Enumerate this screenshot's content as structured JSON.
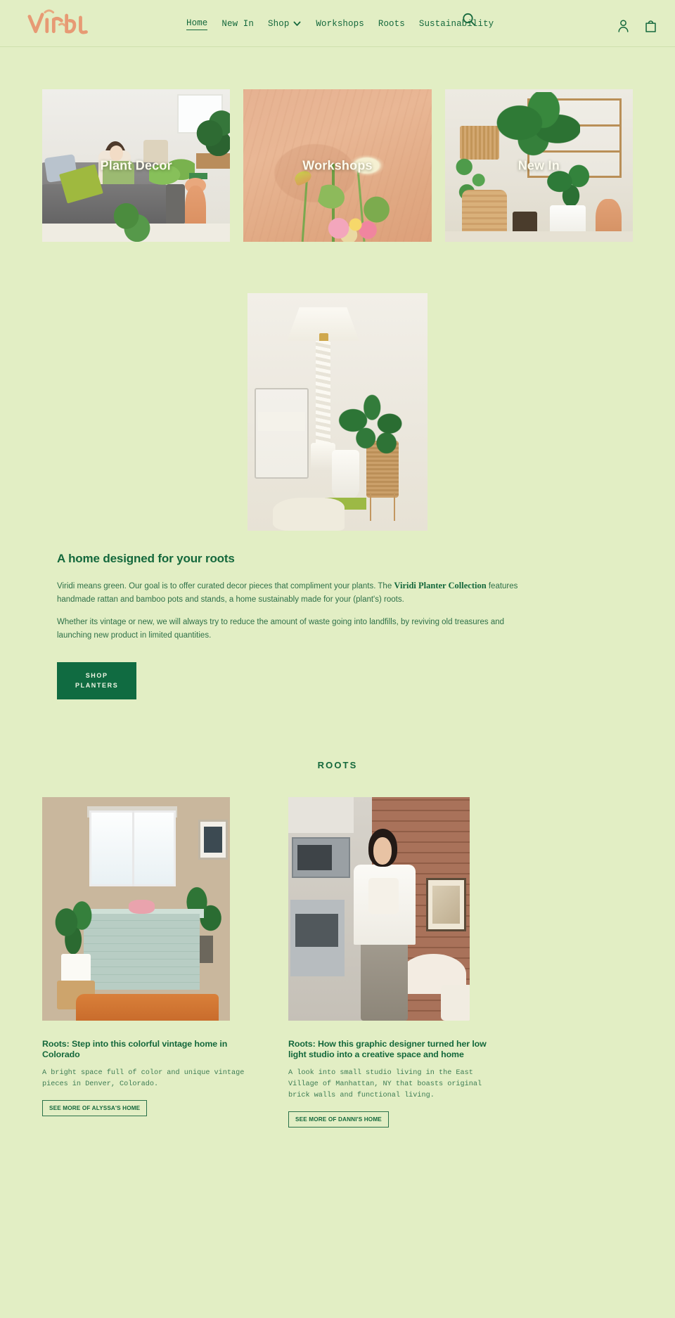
{
  "site": {
    "brand": "Viridi",
    "background_color": "#e2eec4",
    "primary_color": "#14683c",
    "logo_color": "#e79a74"
  },
  "header": {
    "logo_label": "Viridi",
    "nav": [
      {
        "label": "Home",
        "active": true,
        "has_caret": false
      },
      {
        "label": "New In",
        "active": false,
        "has_caret": false
      },
      {
        "label": "Shop",
        "active": false,
        "has_caret": true
      },
      {
        "label": "Workshops",
        "active": false,
        "has_caret": false
      },
      {
        "label": "Roots",
        "active": false,
        "has_caret": false
      },
      {
        "label": "Sustainability",
        "active": false,
        "has_caret": false
      }
    ],
    "search_icon": "search-icon",
    "account_icon": "account-icon",
    "cart_icon": "shopping-bag-icon"
  },
  "categories": [
    {
      "label": "Plant Decor",
      "image_alt": "Woman reading on a grey leather sofa surrounded by houseplants"
    },
    {
      "label": "Workshops",
      "image_alt": "Tulips and flowers against a peach plywood backdrop"
    },
    {
      "label": "New In",
      "image_alt": "Plant shop interior with rattan stands and white planters"
    }
  ],
  "hero": {
    "image_alt": "White twisted floor lamp beside a ZZ plant in a white vase on a green book"
  },
  "about": {
    "heading": "A home designed for your roots",
    "paragraph_1_part_1": "Viridi means green. Our goal is to offer curated decor pieces that compliment your plants. The ",
    "paragraph_1_bold": "Viridi Planter Collection",
    "paragraph_1_part_2": " features handmade rattan and bamboo pots and stands, a home sustainably made for your (plant's) roots.",
    "paragraph_2": "Whether its vintage or new, we will always try to reduce the amount of waste going into landfills, by reviving old treasures and launching new product in limited quantities.",
    "cta_line_1": "SHOP",
    "cta_line_2": "PLANTERS"
  },
  "roots": {
    "section_title": "ROOTS",
    "articles": [
      {
        "title": "Roots: Step into this colorful vintage home in Colorado",
        "excerpt": "A bright space full of color and unique vintage pieces in Denver, Colorado.",
        "cta": "SEE MORE OF ALYSSA'S HOME",
        "image_alt": "Colorful vintage home with green tiled desk, plants and an orange sofa"
      },
      {
        "title": "Roots: How this graphic designer turned her low light studio into a creative space and home",
        "excerpt": "A look into small studio living in the East Village of Manhattan, NY that boasts original brick walls and functional living.",
        "cta": "SEE MORE OF DANNI'S HOME",
        "image_alt": "Woman standing in an East Village studio with exposed brick wall and kitchen"
      }
    ]
  }
}
